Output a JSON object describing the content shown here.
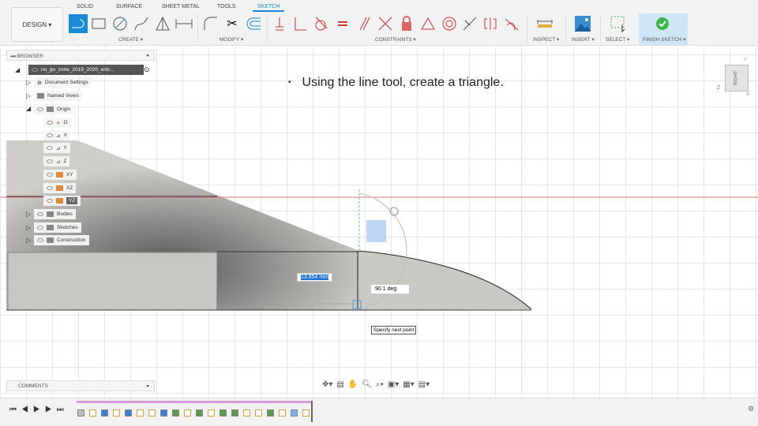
{
  "toolbar": {
    "workspace": "DESIGN ▾",
    "tabs": [
      "SOLID",
      "SURFACE",
      "SHEET METAL",
      "TOOLS",
      "SKETCH"
    ],
    "active_tab": "SKETCH",
    "groups": {
      "create": "CREATE ▾",
      "modify": "MODIFY ▾",
      "constraints": "CONSTRAINTS ▾",
      "inspect": "INSPECT ▾",
      "insert": "INSERT ▾",
      "select": "SELECT ▾",
      "finish": "FINISH SKETCH ▾"
    }
  },
  "browser": {
    "title": "BROWSER",
    "root": "no_go_zone_2019_2020_entr...",
    "items": {
      "doc_settings": "Document Settings",
      "named_views": "Named Views",
      "origin": "Origin",
      "o": "O",
      "x": "X",
      "y": "Y",
      "z": "Z",
      "xy": "XY",
      "xz": "XZ",
      "yz": "YZ",
      "bodies": "Bodies",
      "sketches": "Sketches",
      "construction": "Construction"
    }
  },
  "slide": {
    "bullet": "•",
    "text": "Using the line tool, create a triangle."
  },
  "viewcube": {
    "face": "RIGHT",
    "axis_z": "Z",
    "axis_y": "Y",
    "axis_x": "X"
  },
  "sketch": {
    "length_input": "13.854 mm",
    "angle": "90.1 deg",
    "tooltip": "Specify next point"
  },
  "comments": {
    "title": "COMMENTS"
  },
  "timeline": {
    "items": [
      "body",
      "sketch",
      "extrude",
      "sketch",
      "extrude",
      "sketch",
      "sketch",
      "extrude",
      "fillet",
      "sketch",
      "fillet",
      "sketch",
      "fillet",
      "fillet",
      "sketch",
      "sketch",
      "fillet",
      "sketch",
      "shell",
      "sketch"
    ]
  },
  "colors": {
    "accent": "#1a8ad6",
    "finish_bg": "#cfe6f6",
    "timeline_bar": "#d99ad9"
  }
}
